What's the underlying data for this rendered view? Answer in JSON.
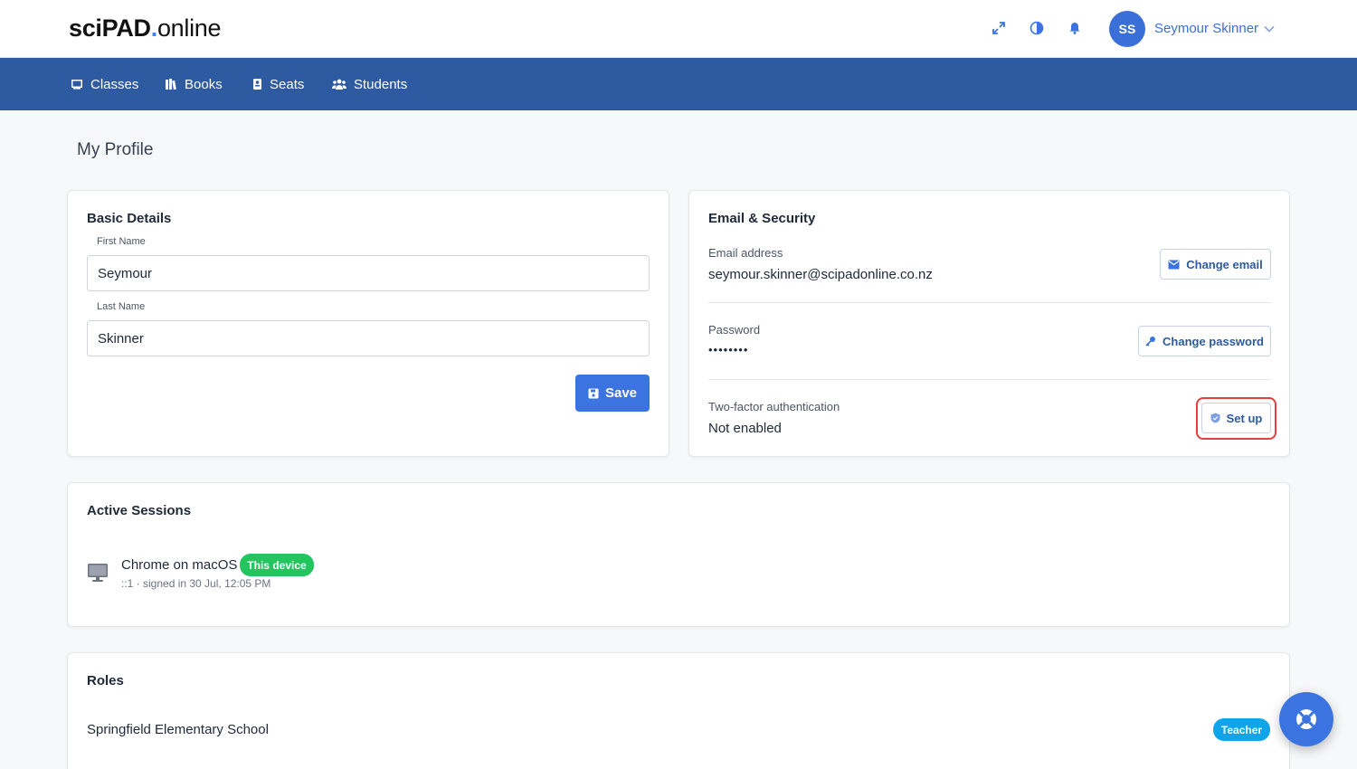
{
  "header": {
    "logo": {
      "part1": "sciPAD",
      "part2": ".",
      "part3": "online"
    },
    "icons": [
      "expand-icon",
      "contrast-icon",
      "bell-icon",
      "chevron-down-icon"
    ],
    "user": {
      "initials": "SS",
      "name": "Seymour Skinner"
    }
  },
  "nav": {
    "items": [
      {
        "label": "Classes",
        "icon": "classes-icon"
      },
      {
        "label": "Books",
        "icon": "books-icon"
      },
      {
        "label": "Seats",
        "icon": "seats-icon"
      },
      {
        "label": "Students",
        "icon": "students-icon"
      }
    ]
  },
  "page": {
    "title": "My Profile"
  },
  "basic_details": {
    "title": "Basic Details",
    "first_name_label": "First Name",
    "first_name_value": "Seymour",
    "last_name_label": "Last Name",
    "last_name_value": "Skinner",
    "save_label": "Save"
  },
  "security": {
    "title": "Email & Security",
    "email_label": "Email address",
    "email_value": "seymour.skinner@scipadonline.co.nz",
    "change_email_label": "Change email",
    "password_label": "Password",
    "password_value": "••••••••",
    "change_password_label": "Change password",
    "twofa_label": "Two-factor authentication",
    "twofa_value": "Not enabled",
    "setup_label": "Set up"
  },
  "sessions": {
    "title": "Active Sessions",
    "items": [
      {
        "device": "Chrome on macOS",
        "badge": "This device",
        "detail": "::1 · signed in 30 Jul, 12:05 PM"
      }
    ]
  },
  "roles": {
    "title": "Roles",
    "items": [
      {
        "school": "Springfield Elementary School",
        "role": "Teacher"
      }
    ]
  },
  "colors": {
    "brand": "#2d5aa0",
    "primary": "#3b74e0",
    "success": "#22c55e",
    "info": "#0ea5e9",
    "highlight": "#e53e3e"
  }
}
